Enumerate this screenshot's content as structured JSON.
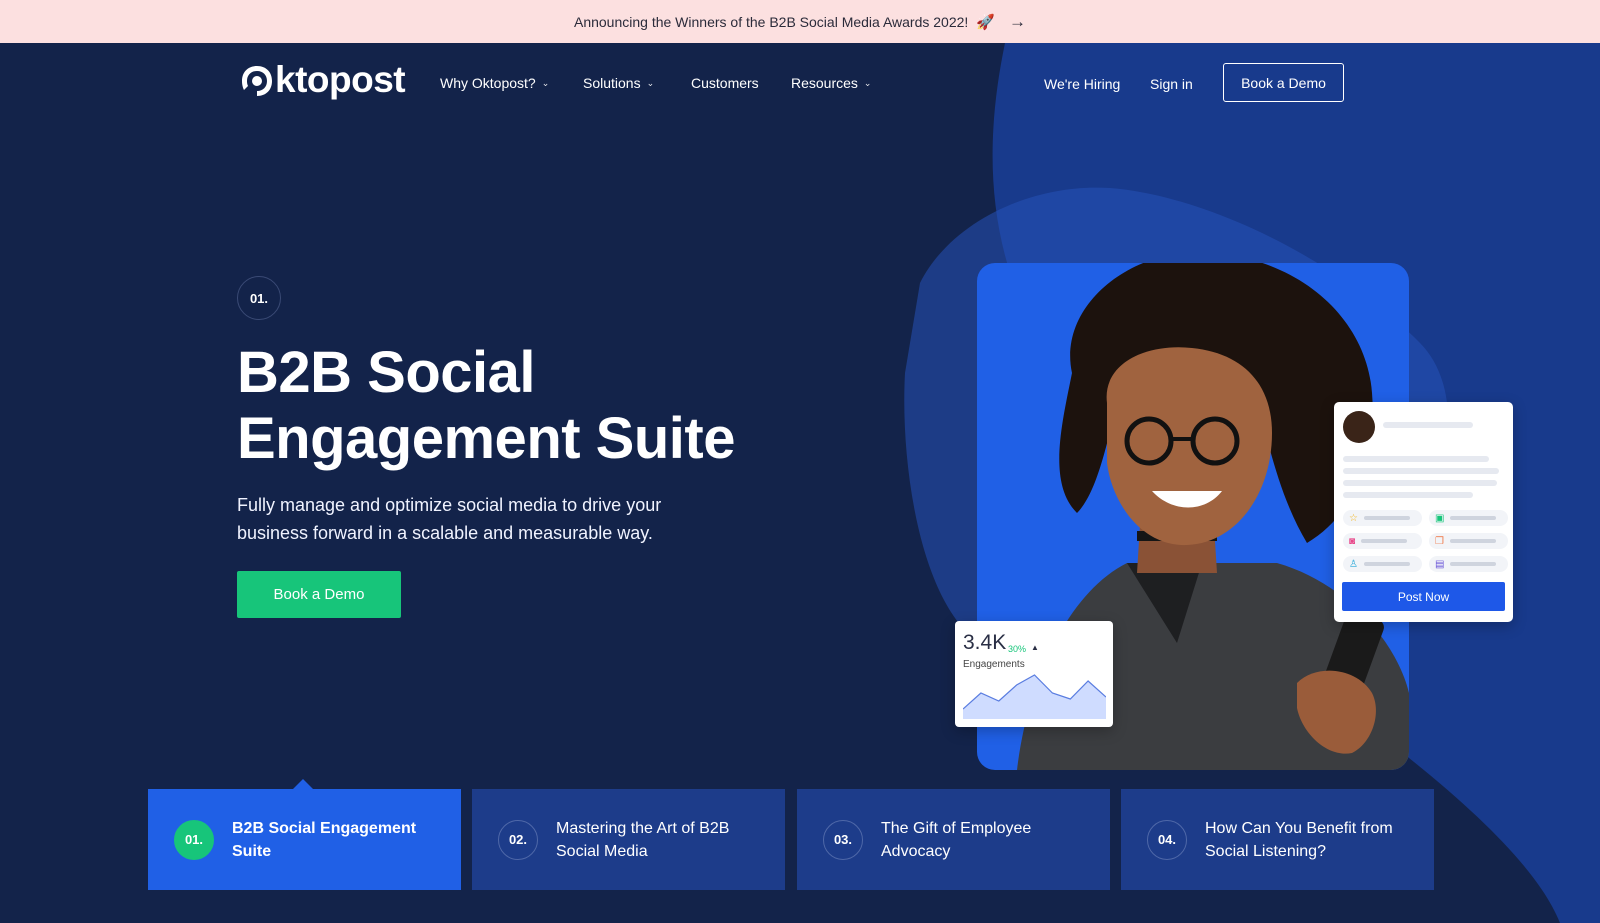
{
  "announcement": {
    "text": "Announcing the Winners of the B2B Social Media Awards 2022!",
    "emoji": "🚀",
    "arrow": "→"
  },
  "brand": {
    "name": "ktopost",
    "accent": "#17c57a",
    "primary_blue": "#2060e6",
    "navy": "#13234a"
  },
  "nav": {
    "items": [
      {
        "label": "Why Oktopost?",
        "has_dropdown": true
      },
      {
        "label": "Solutions",
        "has_dropdown": true
      },
      {
        "label": "Customers",
        "has_dropdown": false
      },
      {
        "label": "Resources",
        "has_dropdown": true
      }
    ],
    "hiring": "We're Hiring",
    "signin": "Sign in",
    "cta": "Book a Demo",
    "chevron": "⌄"
  },
  "hero": {
    "step": "01.",
    "title": "B2B Social Engagement Suite",
    "subtitle": "Fully manage and optimize social media to drive your business forward in a scalable and measurable way.",
    "cta": "Book a Demo"
  },
  "post_card": {
    "button": "Post Now"
  },
  "engagement_card": {
    "value": "3.4K",
    "change": "30%",
    "trend": "▲",
    "label": "Engagements",
    "series": [
      38,
      22,
      30,
      14,
      4,
      22,
      28,
      10,
      26
    ]
  },
  "tabs": [
    {
      "num": "01.",
      "label": "B2B Social Engagement Suite",
      "active": true
    },
    {
      "num": "02.",
      "label": "Mastering the Art of B2B Social Media",
      "active": false
    },
    {
      "num": "03.",
      "label": "The Gift of Employee Advocacy",
      "active": false
    },
    {
      "num": "04.",
      "label": "How Can You Benefit from Social Listening?",
      "active": false
    }
  ]
}
